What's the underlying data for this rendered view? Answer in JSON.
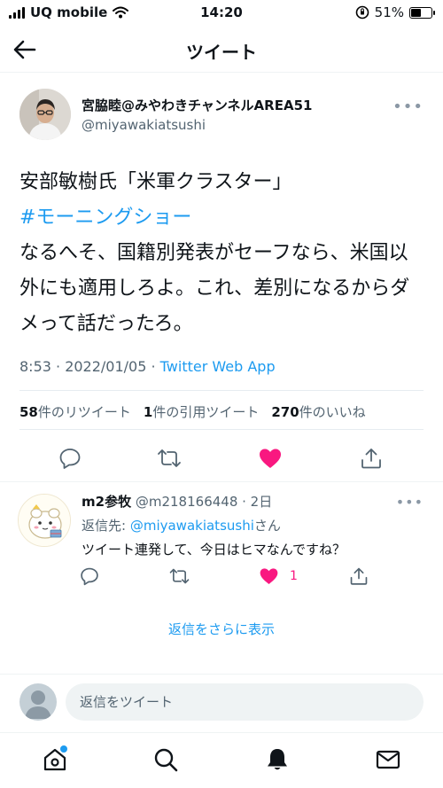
{
  "status_bar": {
    "carrier": "UQ mobile",
    "time": "14:20",
    "battery_percent": "51%",
    "battery_level": 0.51
  },
  "header": {
    "title": "ツイート"
  },
  "tweet": {
    "author_name": "宮脇睦@みやわきチャンネルAREA51",
    "author_handle": "@miyawakiatsushi",
    "text_line1": "安部敏樹氏「米軍クラスター」",
    "hashtag": "#モーニングショー",
    "text_rest": "なるへそ、国籍別発表がセーフなら、米国以外にも適用しろよ。これ、差別になるからダメって話だったろ。",
    "timestamp": "8:53 · 2022/01/05 · ",
    "source": "Twitter Web App",
    "stats": {
      "retweets_count": "58",
      "retweets_label": "件のリツイート",
      "quotes_count": "1",
      "quotes_label": "件の引用ツイート",
      "likes_count": "270",
      "likes_label": "件のいいね"
    }
  },
  "reply": {
    "name": "m2参牧",
    "handle_time": "@m218166448 · 2日",
    "reply_prefix": "返信先: ",
    "reply_mention": "@miyawakiatsushi",
    "reply_suffix": "さん",
    "text": "ツイート連発して、今日はヒマなんですね？",
    "like_count": "1"
  },
  "show_more": "返信をさらに表示",
  "compose": {
    "placeholder": "返信をツイート"
  },
  "colors": {
    "accent": "#1d9bf0",
    "like": "#f91880",
    "secondary_text": "#536471"
  },
  "icons": {
    "back": "arrow-left-icon",
    "reply": "speech-bubble-icon",
    "retweet": "retweet-icon",
    "like": "heart-icon",
    "share": "share-icon",
    "home": "home-icon",
    "search": "search-icon",
    "notifications": "bell-icon",
    "messages": "envelope-icon"
  }
}
